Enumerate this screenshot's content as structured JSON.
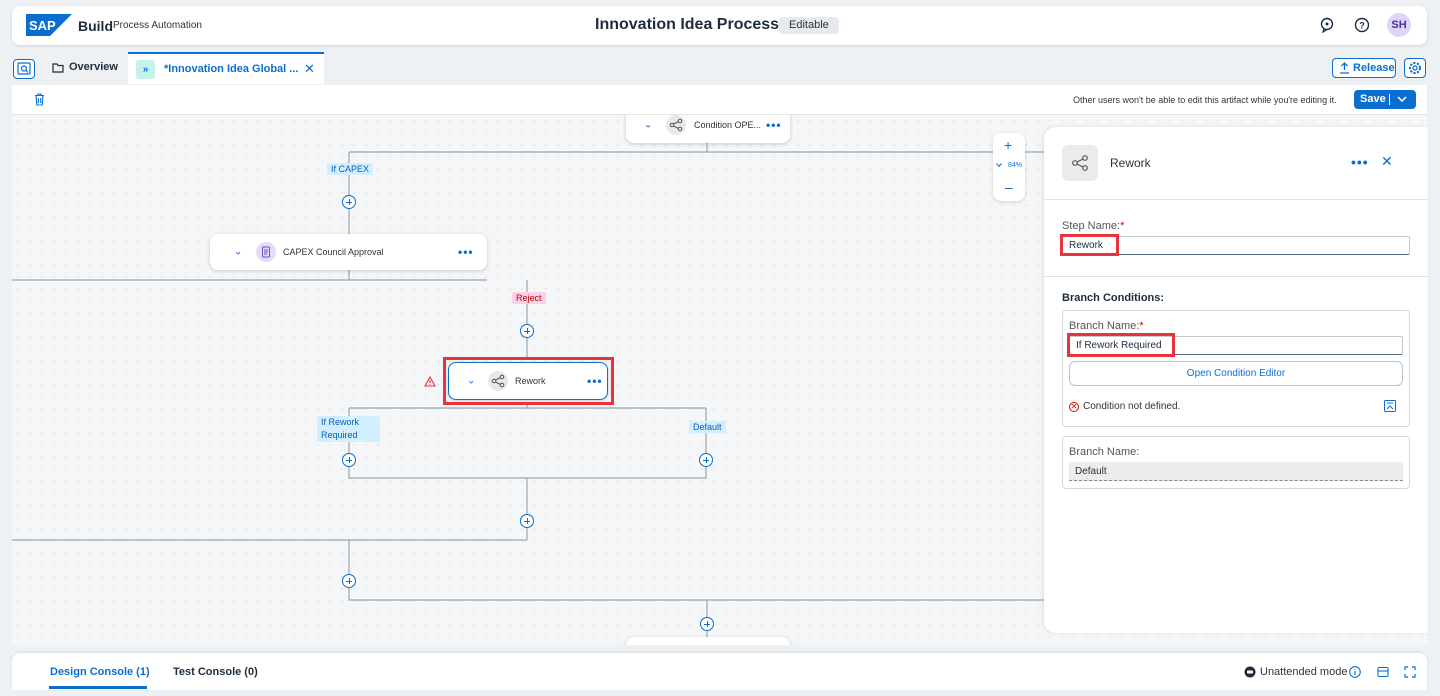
{
  "shell": {
    "brand": "Build",
    "brand_sub": "Process Automation",
    "title": "Innovation Idea Process",
    "status_badge": "Editable",
    "avatar_initials": "SH",
    "icons": [
      "sap-logo",
      "feedback-icon",
      "help-icon"
    ]
  },
  "tabs": {
    "overview": "Overview",
    "active_tab": "*Innovation Idea Global ...",
    "release": "Release"
  },
  "toolbar": {
    "lock_message": "Other users won't be able to edit this artifact while you're editing it.",
    "save": "Save"
  },
  "canvas": {
    "zoom_level": "84%",
    "nodes": {
      "condition_opex": "Condition OPE...",
      "capex_approval": "CAPEX Council Approval",
      "rework": "Rework"
    },
    "branch_labels": {
      "if_capex": "If CAPEX",
      "reject": "Reject",
      "if_rework": "If Rework Required",
      "default": "Default"
    }
  },
  "panel": {
    "title": "Rework",
    "step_name_label": "Step Name:",
    "step_name_value": "Rework",
    "branch_conditions_label": "Branch Conditions:",
    "branch_name_label": "Branch Name:",
    "branch_1_value": "If Rework Required",
    "open_condition_editor": "Open Condition Editor",
    "condition_error": "Condition not defined.",
    "branch_2_label": "Branch Name:",
    "branch_2_value": "Default"
  },
  "console": {
    "design_console": "Design Console (1)",
    "test_console": "Test Console (0)",
    "mode": "Unattended mode"
  },
  "colors": {
    "accent": "#0a6ed1",
    "highlight": "#e8333c",
    "error": "#dd0000"
  }
}
